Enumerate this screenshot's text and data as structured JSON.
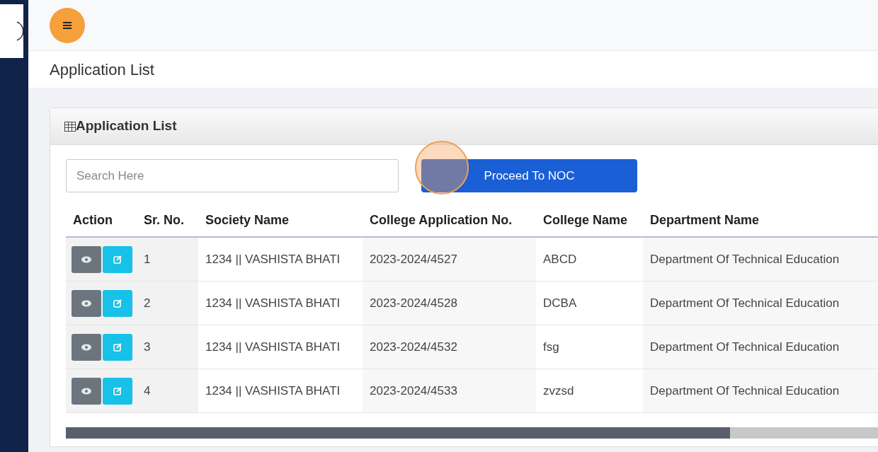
{
  "page_title": "Application List",
  "card": {
    "title": "Application List",
    "search": {
      "placeholder": "Search Here"
    },
    "proceed_button": "Proceed To NOC",
    "table": {
      "columns": [
        "Action",
        "Sr. No.",
        "Society Name",
        "College Application No.",
        "College Name",
        "Department Name"
      ],
      "rows": [
        {
          "sr": "1",
          "society": "1234 || VASHISTA BHATI",
          "app_no": "2023-2024/4527",
          "college": "ABCD",
          "department": "Department Of Technical Education"
        },
        {
          "sr": "2",
          "society": "1234 || VASHISTA BHATI",
          "app_no": "2023-2024/4528",
          "college": "DCBA",
          "department": "Department Of Technical Education"
        },
        {
          "sr": "3",
          "society": "1234 || VASHISTA BHATI",
          "app_no": "2023-2024/4532",
          "college": "fsg",
          "department": "Department Of Technical Education"
        },
        {
          "sr": "4",
          "society": "1234 || VASHISTA BHATI",
          "app_no": "2023-2024/4533",
          "college": "zvzsd",
          "department": "Department Of Technical Education"
        }
      ]
    }
  }
}
